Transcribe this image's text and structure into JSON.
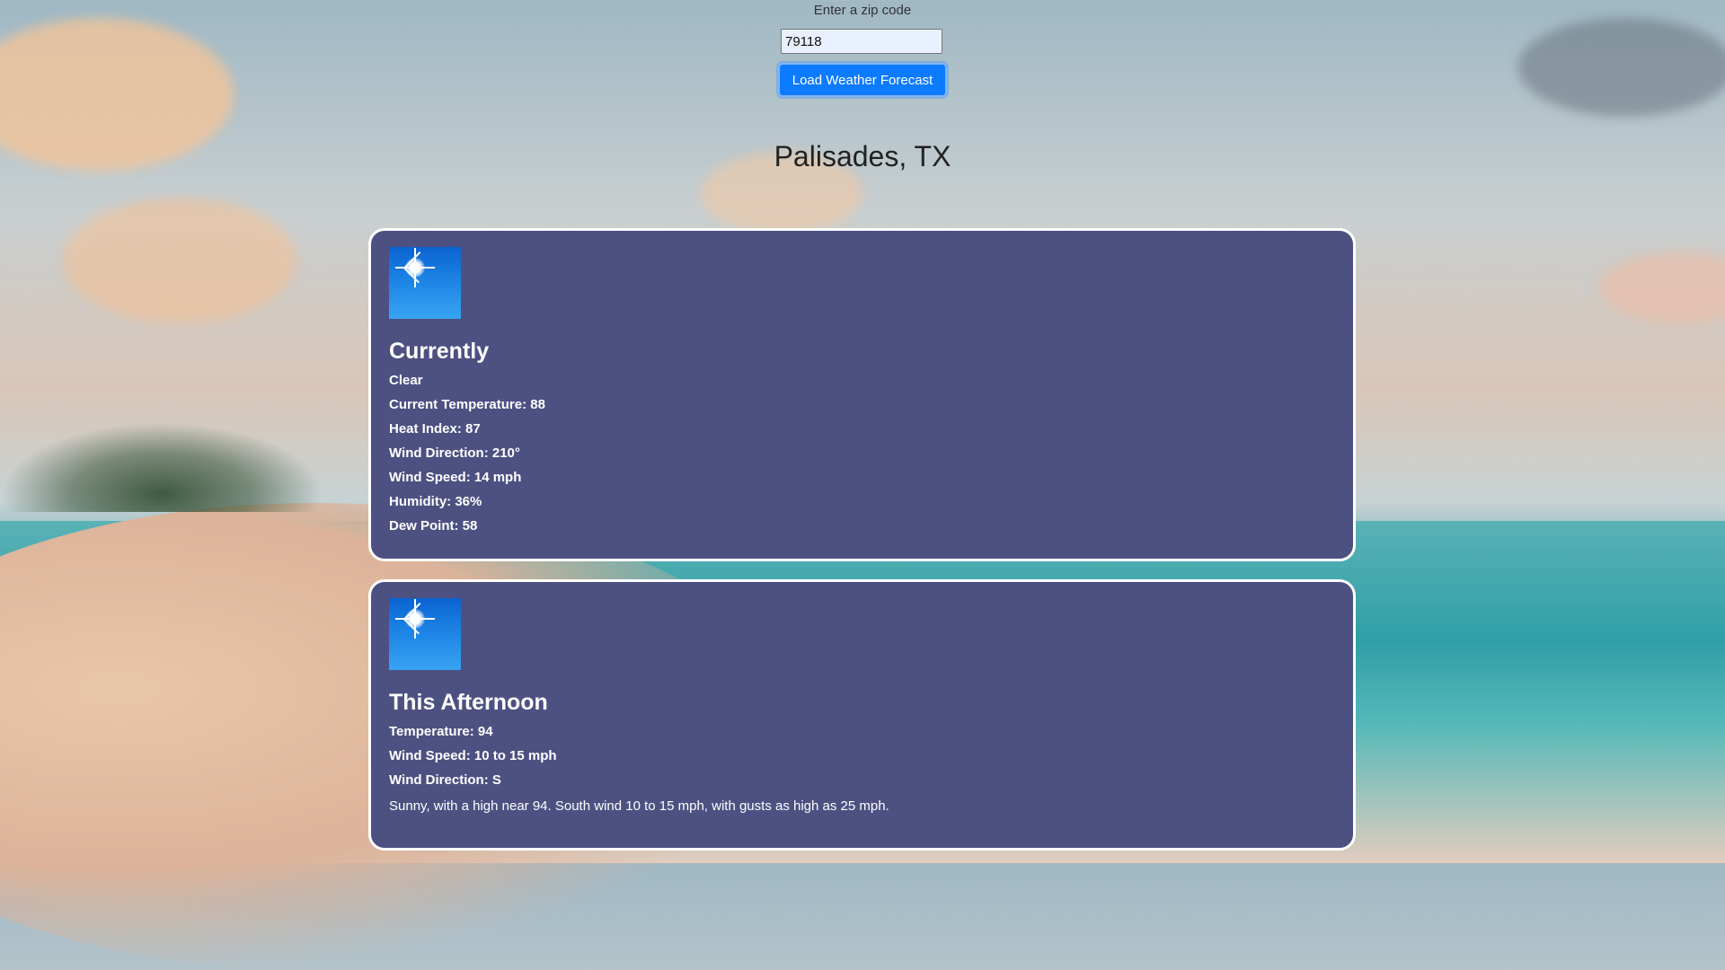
{
  "form": {
    "label": "Enter a zip code",
    "zip_value": "79118",
    "button_label": "Load Weather Forecast"
  },
  "location": "Palisades, TX",
  "current": {
    "icon": "sunny-icon",
    "title": "Currently",
    "condition": "Clear",
    "temperature": "Current Temperature: 88",
    "heat_index": "Heat Index: 87",
    "wind_direction": "Wind Direction: 210°",
    "wind_speed": "Wind Speed: 14 mph",
    "humidity": "Humidity: 36%",
    "dew_point": "Dew Point: 58"
  },
  "forecast": {
    "icon": "sunny-icon",
    "title": "This Afternoon",
    "temperature": "Temperature: 94",
    "wind_speed": "Wind Speed: 10 to 15 mph",
    "wind_direction": "Wind Direction: S",
    "description": "Sunny, with a high near 94. South wind 10 to 15 mph, with gusts as high as 25 mph."
  },
  "colors": {
    "card_bg": "#4c5182",
    "button_bg": "#0d7bff"
  }
}
